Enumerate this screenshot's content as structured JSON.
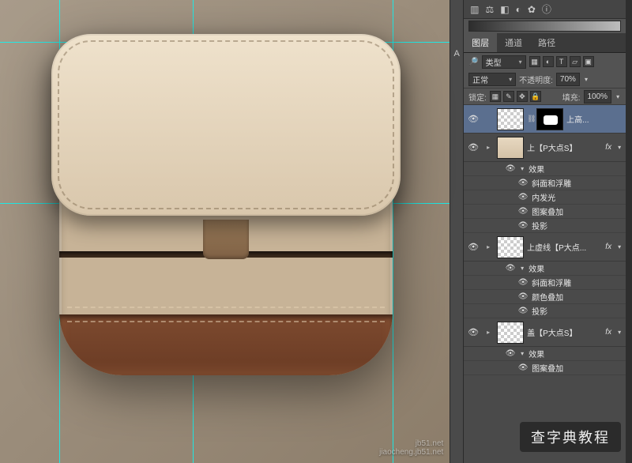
{
  "panel": {
    "tabs": {
      "layers": "图层",
      "channels": "通道",
      "paths": "路径"
    },
    "filter": {
      "kind_label": "类型"
    },
    "blend": {
      "mode": "正常",
      "opacity_label": "不透明度:",
      "opacity_value": "70%"
    },
    "lock": {
      "label": "锁定:",
      "fill_label": "填充:",
      "fill_value": "100%"
    }
  },
  "layers": [
    {
      "name": "上高...",
      "selected": true,
      "has_mask": true,
      "effects": []
    },
    {
      "name": "上【P大点S】",
      "fx": true,
      "thumb": "flap",
      "effects": [
        "效果",
        "斜面和浮雕",
        "内发光",
        "图案叠加",
        "投影"
      ]
    },
    {
      "name": "上虚线【P大点...",
      "fx": true,
      "thumb": "checker",
      "effects": [
        "效果",
        "斜面和浮雕",
        "颜色叠加",
        "投影"
      ]
    },
    {
      "name": "盖【P大点S】",
      "fx": true,
      "thumb": "checker",
      "effects": [
        "效果",
        "图案叠加"
      ]
    }
  ],
  "watermark": {
    "line1": "jb51.net",
    "line2": "jiaocheng.jb51.net"
  },
  "overlay": "查字典教程",
  "tool_glyphs": [
    "A"
  ]
}
